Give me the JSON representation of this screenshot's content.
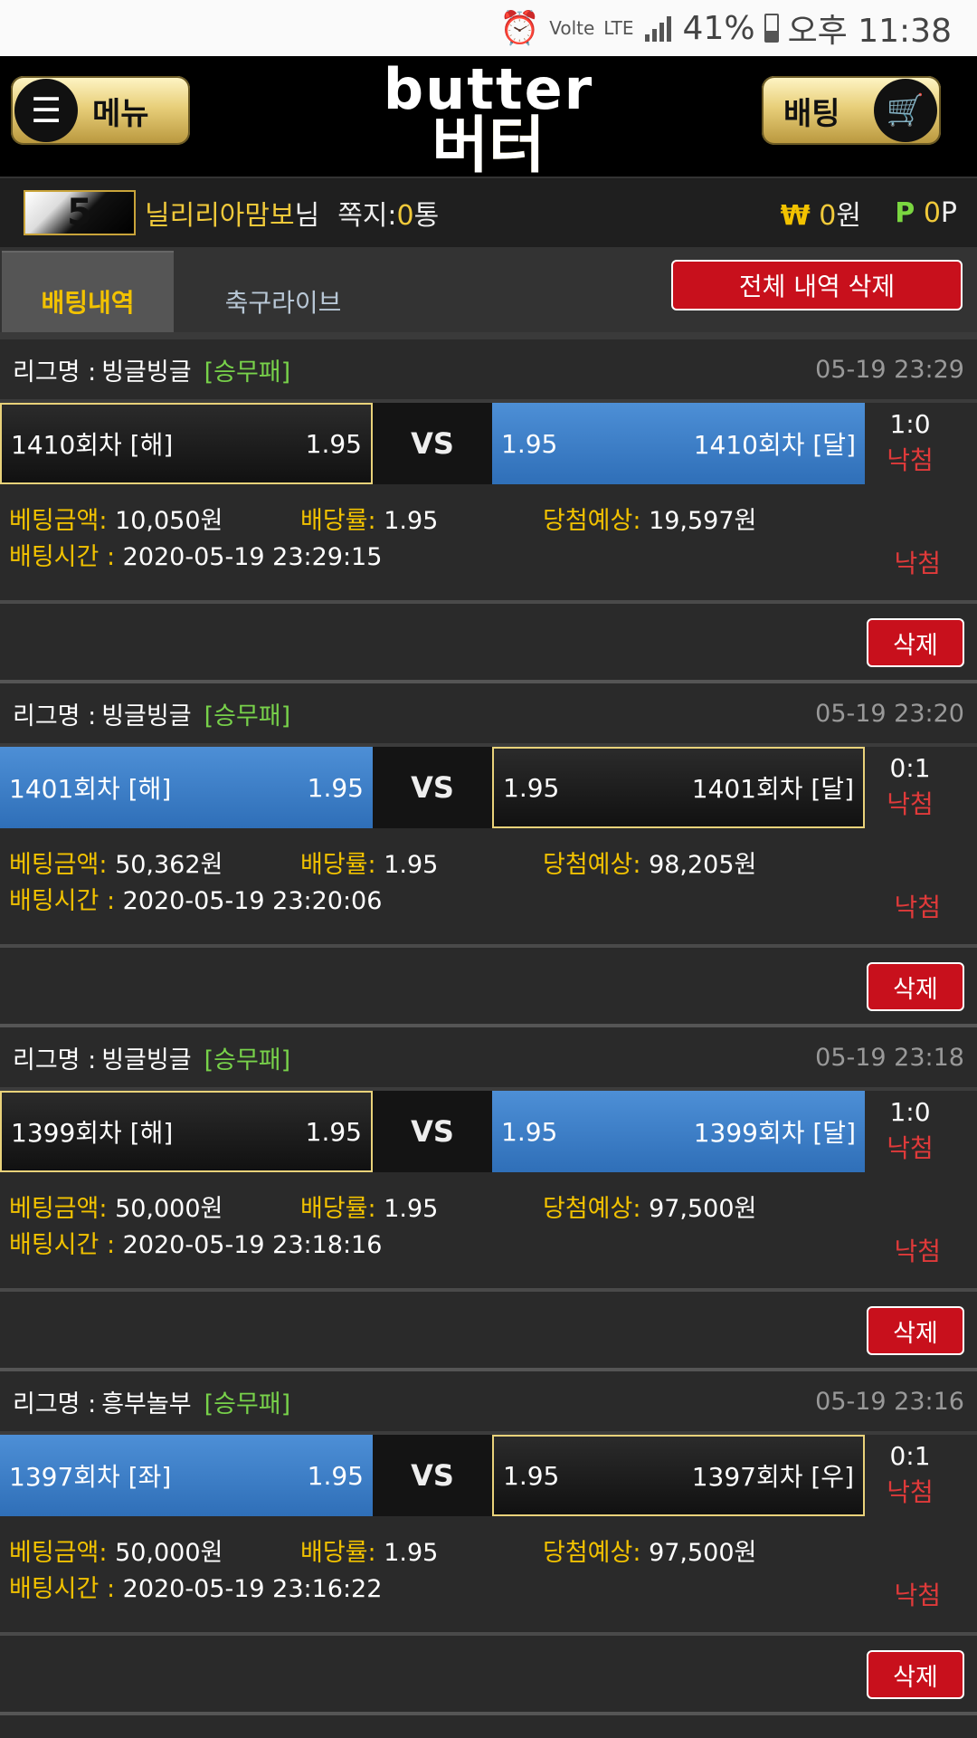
{
  "status_bar": {
    "time": "오후 11:38",
    "battery": "41%",
    "network": "LTE",
    "volte": "Volte"
  },
  "header": {
    "menu_label": "메뉴",
    "logo_en": "butter",
    "logo_ko": "버터",
    "bet_label": "배팅"
  },
  "user": {
    "level": "5",
    "name": "닐리리아맘보",
    "honorific": "님",
    "msg_label": "쪽지:",
    "msg_count": "0",
    "msg_unit": "통",
    "currency_symbol": "₩",
    "money": "0",
    "money_unit": "원",
    "point_symbol": "P",
    "point": "0",
    "point_unit": "P"
  },
  "tabs": {
    "active": "배팅내역",
    "inactive": "축구라이브",
    "delete_all": "전체 내역 삭제"
  },
  "labels": {
    "league": "리그명 :",
    "vs": "VS",
    "amount": "베팅금액:",
    "odds": "배당률:",
    "expected": "당첨예상:",
    "bettime": "배팅시간 :",
    "delete": "삭제"
  },
  "bets": [
    {
      "league": "빙글빙글",
      "type": "[승무패]",
      "time": "05-19 23:29",
      "home": "1410회차 [해]",
      "home_odds": "1.95",
      "away_odds": "1.95",
      "away": "1410회차 [달]",
      "selected": "home",
      "score": "1:0",
      "result": "낙첨",
      "amount": "10,050원",
      "odds": "1.95",
      "expected": "19,597원",
      "bettime": "2020-05-19 23:29:15"
    },
    {
      "league": "빙글빙글",
      "type": "[승무패]",
      "time": "05-19 23:20",
      "home": "1401회차 [해]",
      "home_odds": "1.95",
      "away_odds": "1.95",
      "away": "1401회차 [달]",
      "selected": "away",
      "score": "0:1",
      "result": "낙첨",
      "amount": "50,362원",
      "odds": "1.95",
      "expected": "98,205원",
      "bettime": "2020-05-19 23:20:06"
    },
    {
      "league": "빙글빙글",
      "type": "[승무패]",
      "time": "05-19 23:18",
      "home": "1399회차 [해]",
      "home_odds": "1.95",
      "away_odds": "1.95",
      "away": "1399회차 [달]",
      "selected": "home",
      "score": "1:0",
      "result": "낙첨",
      "amount": "50,000원",
      "odds": "1.95",
      "expected": "97,500원",
      "bettime": "2020-05-19 23:18:16"
    },
    {
      "league": "흥부놀부",
      "type": "[승무패]",
      "time": "05-19 23:16",
      "home": "1397회차 [좌]",
      "home_odds": "1.95",
      "away_odds": "1.95",
      "away": "1397회차 [우]",
      "selected": "away",
      "score": "0:1",
      "result": "낙첨",
      "amount": "50,000원",
      "odds": "1.95",
      "expected": "97,500원",
      "bettime": "2020-05-19 23:16:22"
    }
  ],
  "colors": {
    "gold": "#f2c200",
    "red_button": "#c8101c",
    "blue_team": "#3a7cc7",
    "green_type": "#78d24a",
    "lose_red": "#e03a3a"
  }
}
